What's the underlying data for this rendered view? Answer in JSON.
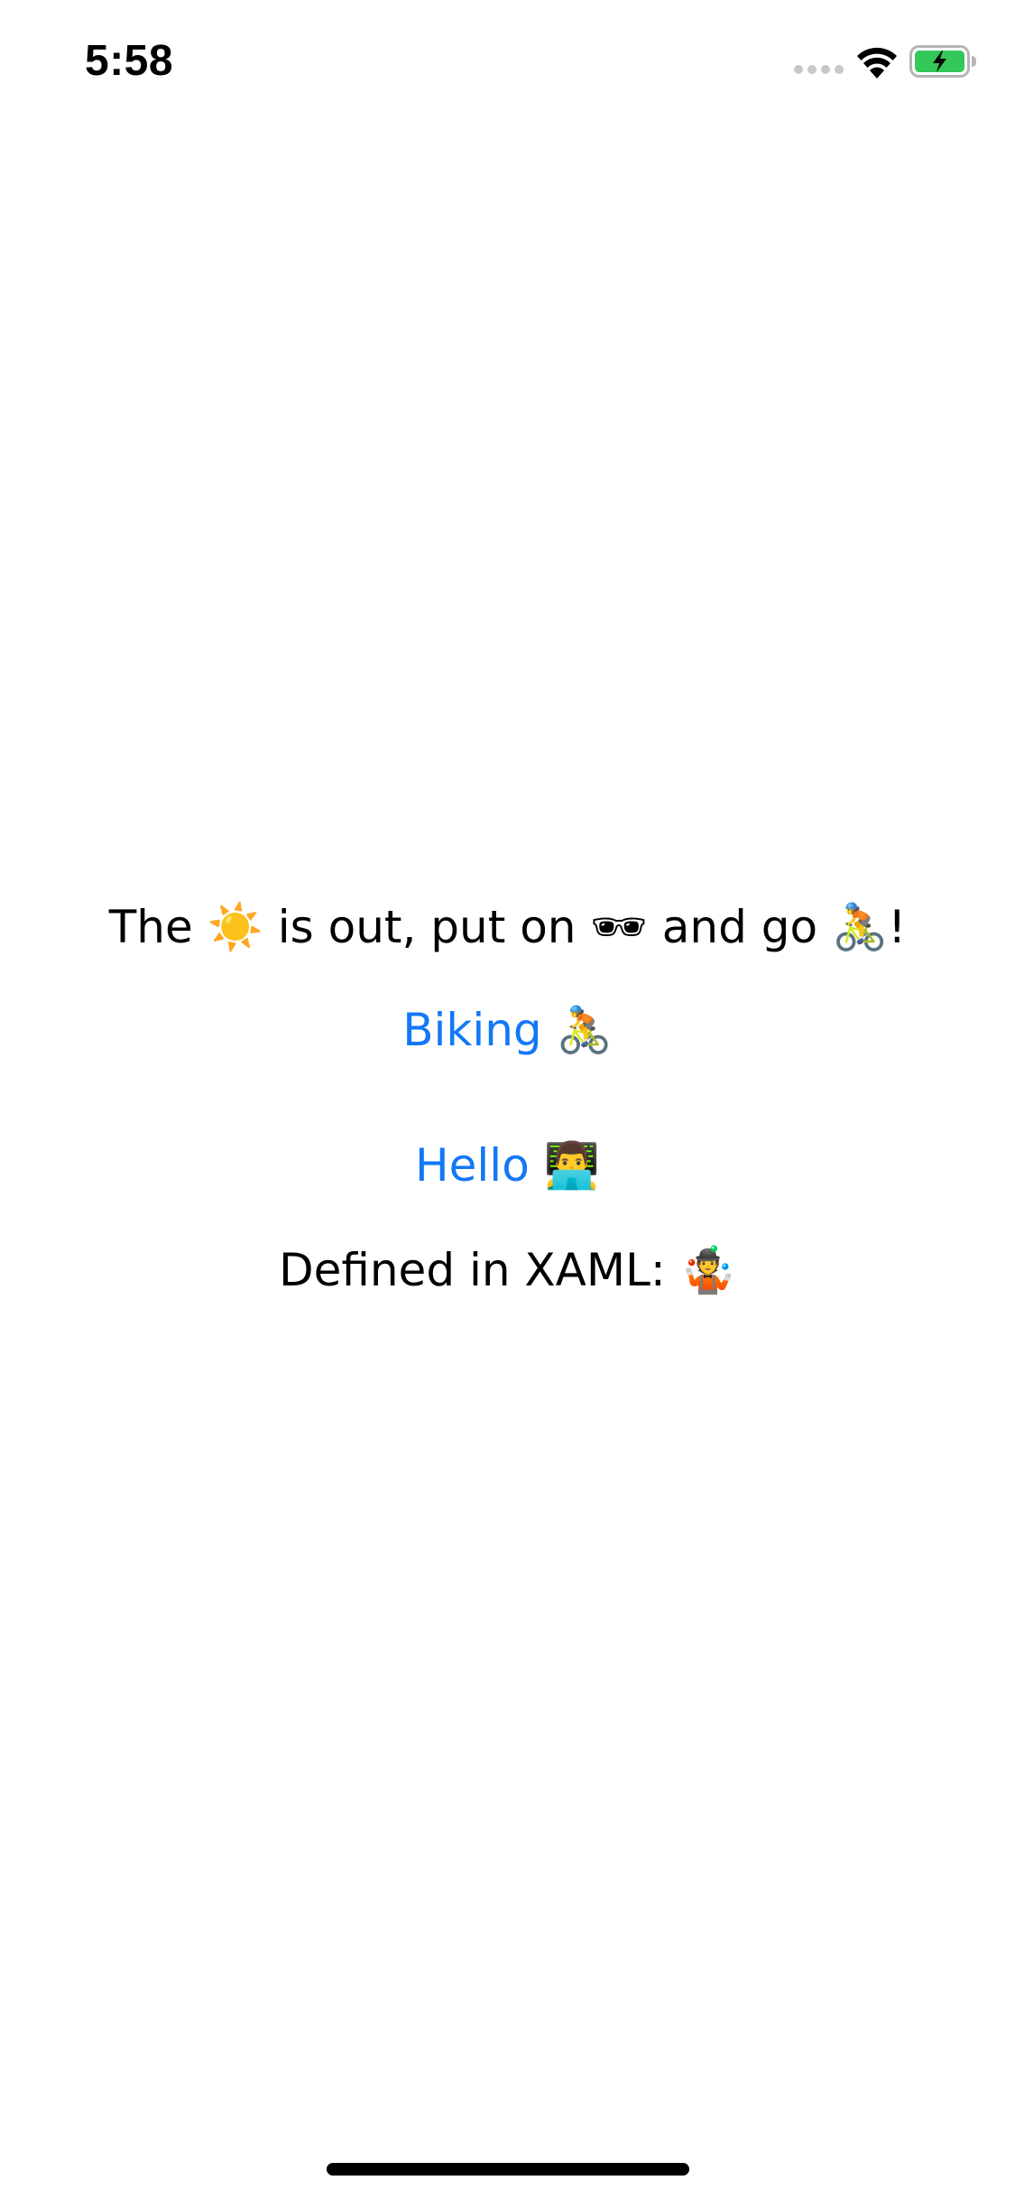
{
  "status_bar": {
    "time": "5:58",
    "signal_icon": "cellular-signal-empty-icon",
    "wifi_icon": "wifi-icon",
    "battery_icon": "battery-charging-icon",
    "battery_color": "#34c759"
  },
  "main": {
    "headline": "The ☀️ is out, put on 🕶 and go 🚴!",
    "biking_button": "Biking 🚴",
    "hello_button": "Hello 👨‍💻",
    "xaml_label": "Defined in XAML:  🤹"
  },
  "colors": {
    "link": "#1378f5",
    "text": "#000000",
    "background": "#ffffff"
  }
}
